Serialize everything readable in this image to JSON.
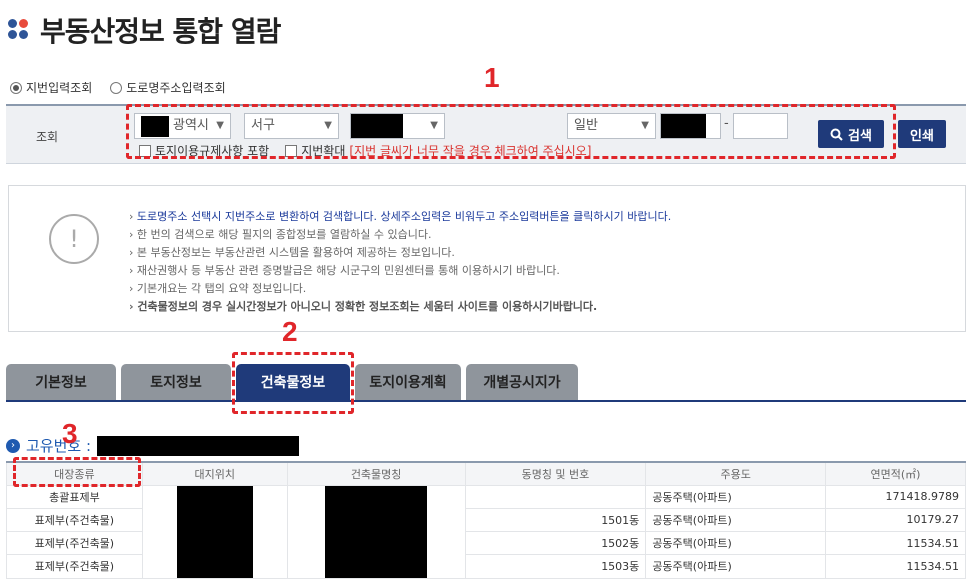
{
  "page": {
    "title": "부동산정보 통합 열람"
  },
  "search_mode": {
    "options": [
      {
        "label": "지번입력조회",
        "selected": true
      },
      {
        "label": "도로명주소입력조회",
        "selected": false
      }
    ]
  },
  "search": {
    "label": "조회",
    "city_suffix": "광역시",
    "district": "서구",
    "land_type": "일반",
    "checkboxes": [
      {
        "label": "토지이용규제사항 포함",
        "checked": false
      },
      {
        "label": "지번확대",
        "checked": false
      }
    ],
    "enlarge_hint": "[지번 글씨가 너무 작을 경우 체크하여 주십시오]",
    "search_button": "검색",
    "print_button": "인쇄"
  },
  "notice": {
    "items": [
      {
        "text": "도로명주소 선택시 지번주소로 변환하여 검색합니다. 상세주소입력은 비워두고 주소입력버튼을 클릭하시기 바랍니다.",
        "style": "blue"
      },
      {
        "text": "한 번의 검색으로 해당 필지의 종합정보를 열람하실 수 있습니다.",
        "style": "normal"
      },
      {
        "text": "본 부동산정보는 부동산관련 시스템을 활용하여 제공하는 정보입니다.",
        "style": "normal"
      },
      {
        "text": "재산권행사 등 부동산 관련 증명발급은 해당 시군구의 민원센터를 통해 이용하시기 바랍니다.",
        "style": "normal"
      },
      {
        "text": "기본개요는 각 탭의 요약 정보입니다.",
        "style": "normal"
      },
      {
        "text": "건축물정보의 경우 실시간정보가 아니오니 정확한 정보조회는 세움터 사이트를 이용하시기바랍니다.",
        "style": "bold"
      }
    ]
  },
  "tabs": [
    {
      "label": "기본정보",
      "active": false
    },
    {
      "label": "토지정보",
      "active": false
    },
    {
      "label": "건축물정보",
      "active": true
    },
    {
      "label": "토지이용계획",
      "active": false
    },
    {
      "label": "개별공시지가",
      "active": false
    }
  ],
  "section": {
    "title": "고유번호 :"
  },
  "table": {
    "headers": [
      "대장종류",
      "대지위치",
      "건축물명칭",
      "동명칭 및 번호",
      "주용도",
      "연면적(㎡)"
    ],
    "rows": [
      {
        "type": "총괄표제부",
        "dong": "",
        "use": "공동주택(아파트)",
        "area": "171418.9789"
      },
      {
        "type": "표제부(주건축물)",
        "dong": "1501동",
        "use": "공동주택(아파트)",
        "area": "10179.27"
      },
      {
        "type": "표제부(주건축물)",
        "dong": "1502동",
        "use": "공동주택(아파트)",
        "area": "11534.51"
      },
      {
        "type": "표제부(주건축물)",
        "dong": "1503동",
        "use": "공동주택(아파트)",
        "area": "11534.51"
      }
    ]
  },
  "annotations": [
    "1",
    "2",
    "3"
  ],
  "colors": {
    "accent": "#1f3a7a",
    "annotation": "#e0262a",
    "notice_blue": "#1b3a9b"
  }
}
